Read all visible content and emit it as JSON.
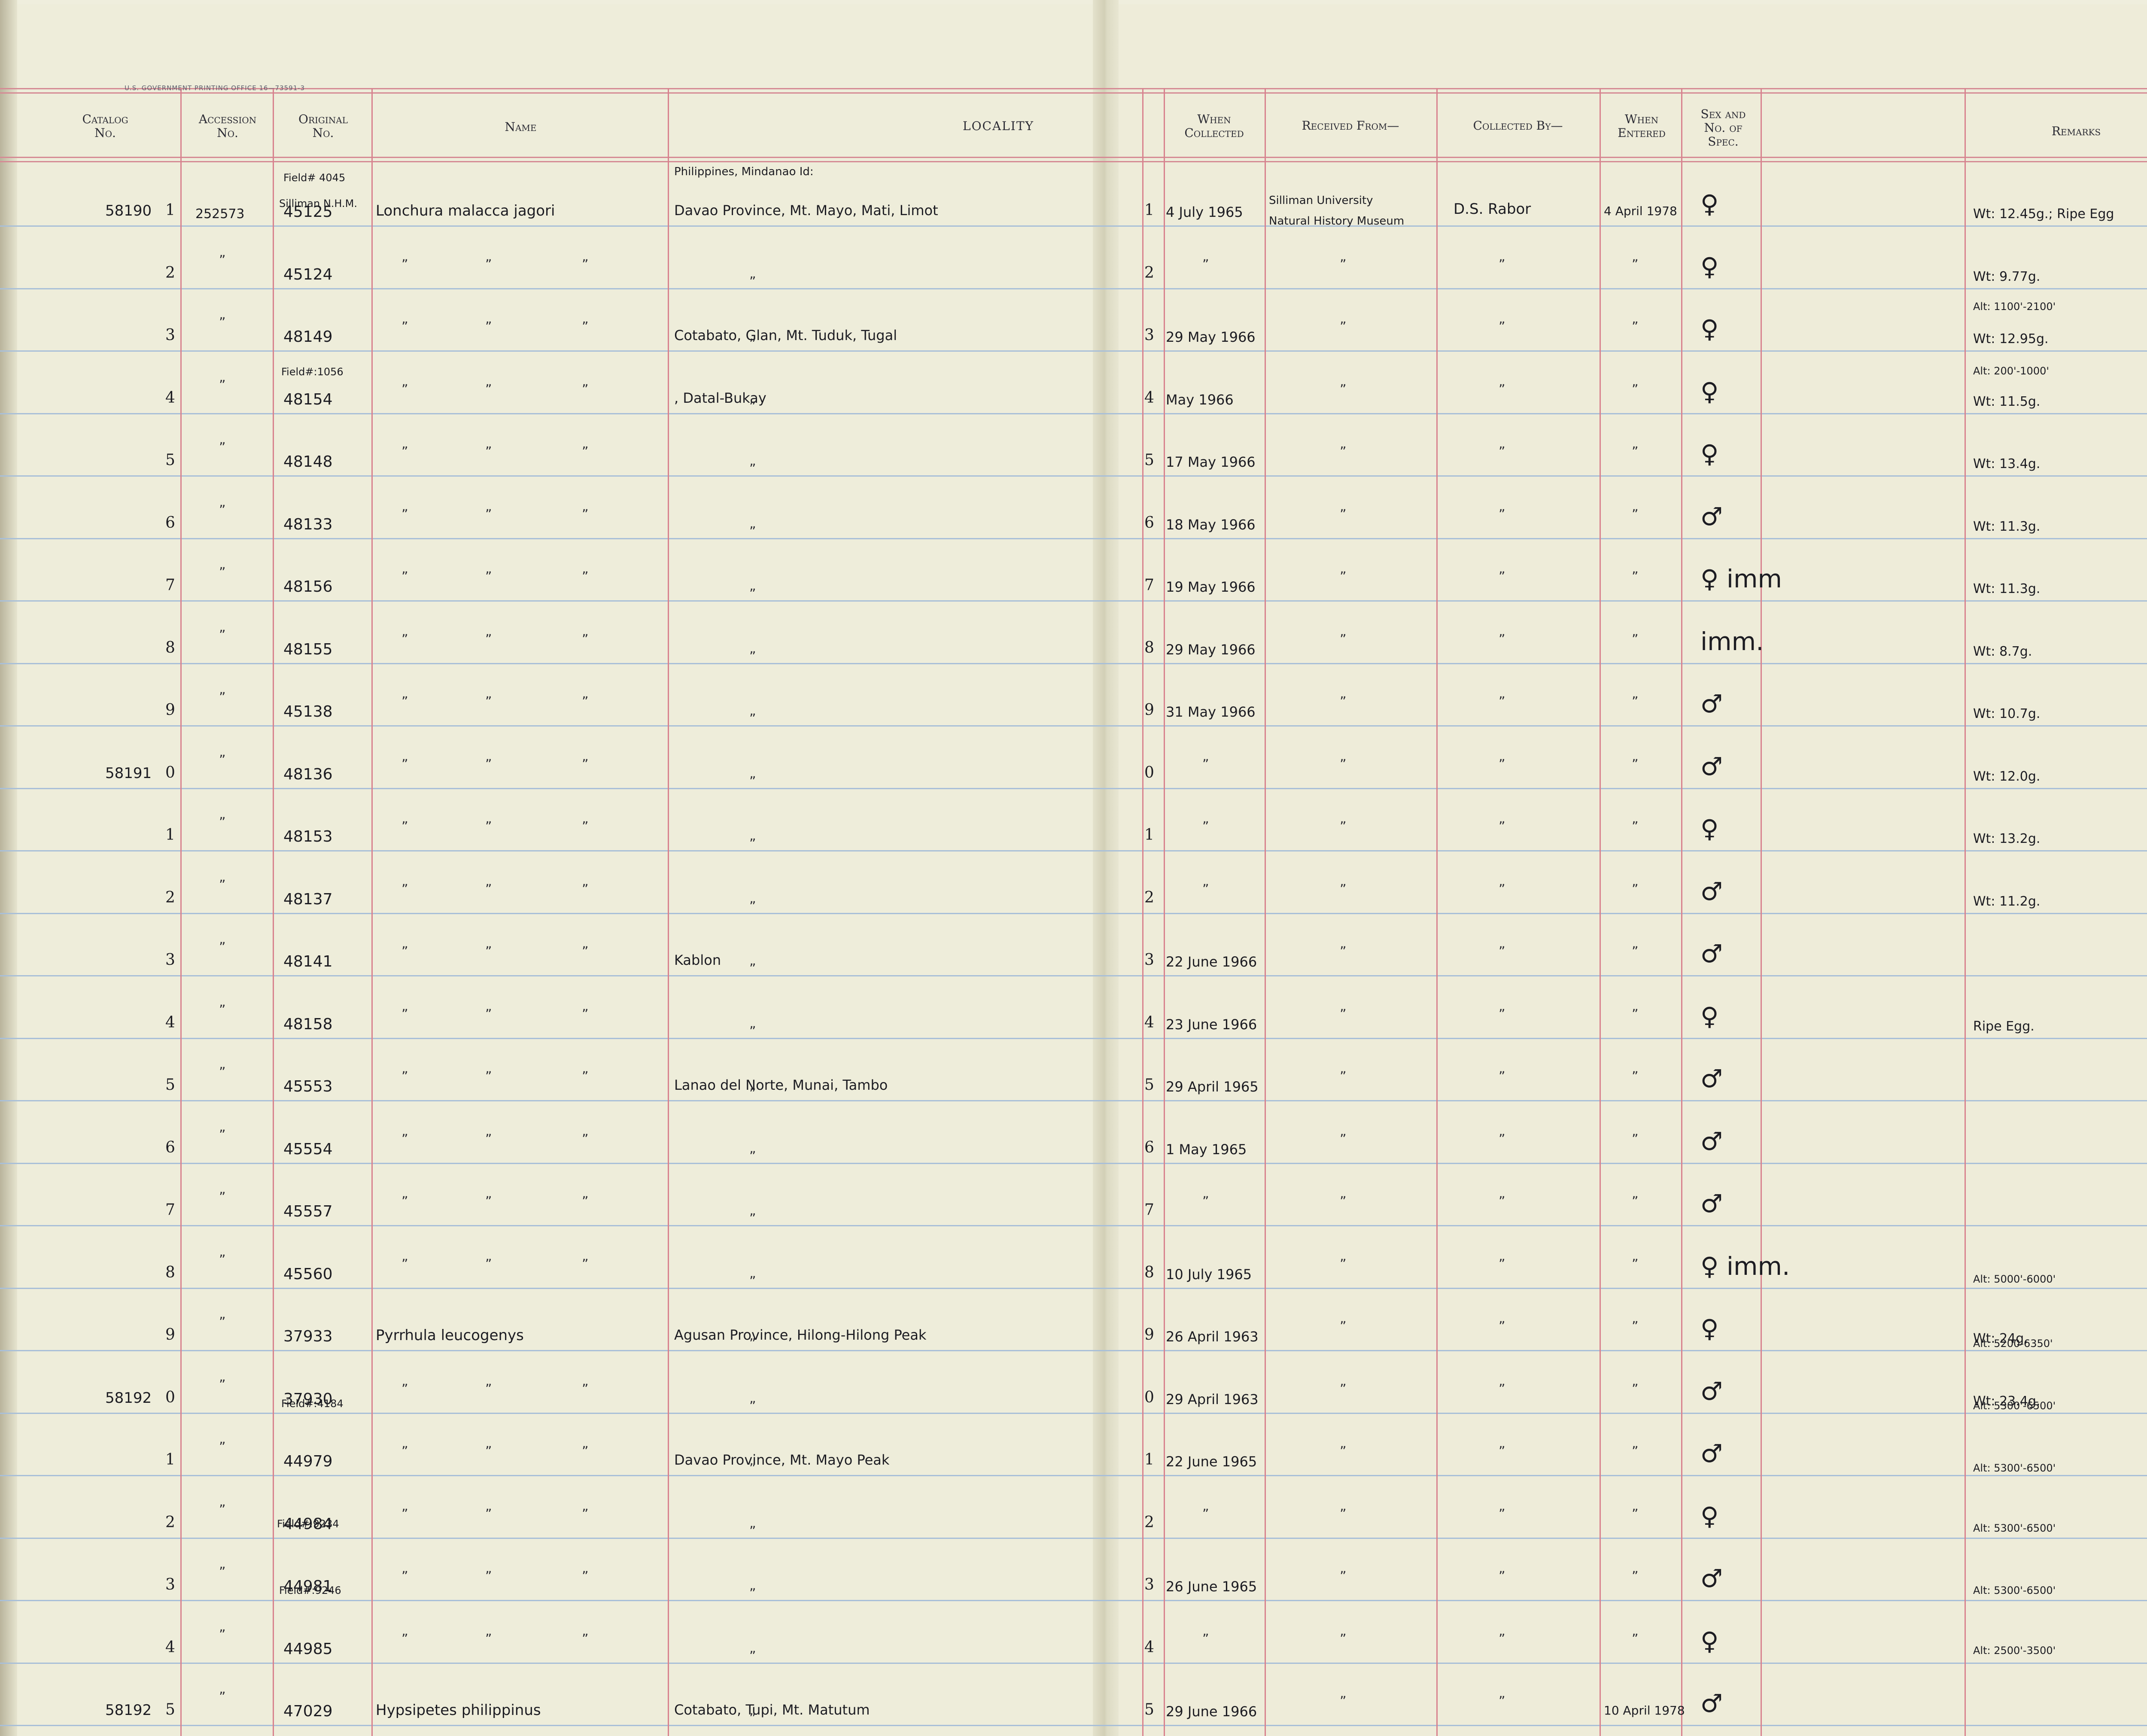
{
  "print_header": "U.S. GOVERNMENT PRINTING OFFICE   16—73591-3",
  "columns": {
    "catalog": [
      "Catalog",
      "No."
    ],
    "accession": [
      "Accession",
      "No."
    ],
    "original": [
      "Original",
      "No."
    ],
    "name": [
      "Name"
    ],
    "locality": [
      "LOCALITY"
    ],
    "when_collected": [
      "When",
      "Collected"
    ],
    "received_from": [
      "Received From—"
    ],
    "collected_by": [
      "Collected By—"
    ],
    "when_entered": [
      "When",
      "Entered"
    ],
    "sex": [
      "Sex and",
      "No. of",
      "Spec."
    ],
    "remarks": [
      "Remarks"
    ]
  },
  "notes": {
    "field_4045": "Field# 4045",
    "silliman_nhm": "Silliman N.H.M.",
    "locality_head": "Philippines, Mindanao Id:",
    "received_line1": "Silliman University",
    "received_line2": "Natural History Museum",
    "field_1056": "Field#:1056",
    "field_4184": "Field#:4184",
    "field_9234": "Field#:9234",
    "field_9246": "Field#:9246",
    "rem_alt_1": "Alt: 1100'-2100'",
    "rem_alt_3": "Alt: 200'-1000'",
    "rem_alt_18": "Alt: 5000'-6000'",
    "rem_alt_19": "Alt: 5200-6350'",
    "rem_alt_20": "Alt: 5300'-6500'",
    "rem_alt_21": "Alt: 5300'-6500'",
    "rem_alt_22": "Alt: 5300'-6500'",
    "rem_alt_23": "Alt: 5300'-6500'",
    "rem_alt_24": "Alt: 2500'-3500'"
  },
  "rows": [
    {
      "cat": "58190",
      "n": "1",
      "acc": "252573",
      "orig": "45125",
      "name": "Lonchura malacca jagori",
      "loc": "Davao Province, Mt. Mayo, Mati, Limot",
      "n2": "1",
      "when": "4 July 1965",
      "coll": "D.S. Rabor",
      "ent": "4 April 1978",
      "sex": "♀",
      "rem": "Wt: 12.45g.; Ripe Egg"
    },
    {
      "cat": "",
      "n": "2",
      "acc": "",
      "orig": "45124",
      "name": "",
      "loc": "",
      "n2": "2",
      "when": "",
      "coll": "",
      "ent": "",
      "sex": "♀",
      "rem": "Wt: 9.77g."
    },
    {
      "cat": "",
      "n": "3",
      "acc": "",
      "orig": "48149",
      "name": "",
      "loc": "Cotabato, Glan, Mt. Tuduk, Tugal",
      "n2": "3",
      "when": "29 May 1966",
      "coll": "",
      "ent": "",
      "sex": "♀",
      "rem": "Wt: 12.95g."
    },
    {
      "cat": "",
      "n": "4",
      "acc": "",
      "orig": "48154",
      "name": "",
      "loc": ", Datal-Bukay",
      "n2": "4",
      "when": "May 1966",
      "coll": "",
      "ent": "",
      "sex": "♀",
      "rem": "Wt: 11.5g."
    },
    {
      "cat": "",
      "n": "5",
      "acc": "",
      "orig": "48148",
      "name": "",
      "loc": "",
      "n2": "5",
      "when": "17 May 1966",
      "coll": "",
      "ent": "",
      "sex": "♀",
      "rem": "Wt: 13.4g."
    },
    {
      "cat": "",
      "n": "6",
      "acc": "",
      "orig": "48133",
      "name": "",
      "loc": "",
      "n2": "6",
      "when": "18 May 1966",
      "coll": "",
      "ent": "",
      "sex": "♂",
      "rem": "Wt: 11.3g."
    },
    {
      "cat": "",
      "n": "7",
      "acc": "",
      "orig": "48156",
      "name": "",
      "loc": "",
      "n2": "7",
      "when": "19 May 1966",
      "coll": "",
      "ent": "",
      "sex": "♀ imm",
      "rem": "Wt: 11.3g."
    },
    {
      "cat": "",
      "n": "8",
      "acc": "",
      "orig": "48155",
      "name": "",
      "loc": "",
      "n2": "8",
      "when": "29 May 1966",
      "coll": "",
      "ent": "",
      "sex": "imm.",
      "rem": "Wt: 8.7g."
    },
    {
      "cat": "",
      "n": "9",
      "acc": "",
      "orig": "45138",
      "name": "",
      "loc": "",
      "n2": "9",
      "when": "31 May 1966",
      "coll": "",
      "ent": "",
      "sex": "♂",
      "rem": "Wt: 10.7g."
    },
    {
      "cat": "58191",
      "n": "0",
      "acc": "",
      "orig": "48136",
      "name": "",
      "loc": "",
      "n2": "0",
      "when": "",
      "coll": "",
      "ent": "",
      "sex": "♂",
      "rem": "Wt: 12.0g."
    },
    {
      "cat": "",
      "n": "1",
      "acc": "",
      "orig": "48153",
      "name": "",
      "loc": "",
      "n2": "1",
      "when": "",
      "coll": "",
      "ent": "",
      "sex": "♀",
      "rem": "Wt: 13.2g."
    },
    {
      "cat": "",
      "n": "2",
      "acc": "",
      "orig": "48137",
      "name": "",
      "loc": "",
      "n2": "2",
      "when": "",
      "coll": "",
      "ent": "",
      "sex": "♂",
      "rem": "Wt: 11.2g."
    },
    {
      "cat": "",
      "n": "3",
      "acc": "",
      "orig": "48141",
      "name": "",
      "loc": "Kablon",
      "n2": "3",
      "when": "22 June 1966",
      "coll": "",
      "ent": "",
      "sex": "♂",
      "rem": ""
    },
    {
      "cat": "",
      "n": "4",
      "acc": "",
      "orig": "48158",
      "name": "",
      "loc": "",
      "n2": "4",
      "when": "23 June 1966",
      "coll": "",
      "ent": "",
      "sex": "♀",
      "rem": "Ripe Egg."
    },
    {
      "cat": "",
      "n": "5",
      "acc": "",
      "orig": "45553",
      "name": "",
      "loc": "Lanao del Norte, Munai, Tambo",
      "n2": "5",
      "when": "29 April 1965",
      "coll": "",
      "ent": "",
      "sex": "♂",
      "rem": ""
    },
    {
      "cat": "",
      "n": "6",
      "acc": "",
      "orig": "45554",
      "name": "",
      "loc": "",
      "n2": "6",
      "when": "1 May 1965",
      "coll": "",
      "ent": "",
      "sex": "♂",
      "rem": ""
    },
    {
      "cat": "",
      "n": "7",
      "acc": "",
      "orig": "45557",
      "name": "",
      "loc": "",
      "n2": "7",
      "when": "",
      "coll": "",
      "ent": "",
      "sex": "♂",
      "rem": ""
    },
    {
      "cat": "",
      "n": "8",
      "acc": "",
      "orig": "45560",
      "name": "",
      "loc": "",
      "n2": "8",
      "when": "10 July 1965",
      "coll": "",
      "ent": "",
      "sex": "♀ imm.",
      "rem": ""
    },
    {
      "cat": "",
      "n": "9",
      "acc": "",
      "orig": "37933",
      "name": "Pyrrhula leucogenys",
      "loc": "Agusan Province, Hilong-Hilong Peak",
      "n2": "9",
      "when": "26 April 1963",
      "coll": "",
      "ent": "",
      "sex": "♀",
      "rem": "Wt: 24g."
    },
    {
      "cat": "58192",
      "n": "0",
      "acc": "",
      "orig": "37930",
      "name": "",
      "loc": "",
      "n2": "0",
      "when": "29 April 1963",
      "coll": "",
      "ent": "",
      "sex": "♂",
      "rem": "Wt: 23.4g."
    },
    {
      "cat": "",
      "n": "1",
      "acc": "",
      "orig": "44979",
      "name": "",
      "loc": "Davao Province, Mt. Mayo Peak",
      "n2": "1",
      "when": "22 June 1965",
      "coll": "",
      "ent": "",
      "sex": "♂",
      "rem": ""
    },
    {
      "cat": "",
      "n": "2",
      "acc": "",
      "orig": "44984",
      "name": "",
      "loc": "",
      "n2": "2",
      "when": "",
      "coll": "",
      "ent": "",
      "sex": "♀",
      "rem": ""
    },
    {
      "cat": "",
      "n": "3",
      "acc": "",
      "orig": "44981",
      "name": "",
      "loc": "",
      "n2": "3",
      "when": "26 June 1965",
      "coll": "",
      "ent": "",
      "sex": "♂",
      "rem": ""
    },
    {
      "cat": "",
      "n": "4",
      "acc": "",
      "orig": "44985",
      "name": "",
      "loc": "",
      "n2": "4",
      "when": "",
      "coll": "",
      "ent": "",
      "sex": "♀",
      "rem": ""
    },
    {
      "cat": "58192",
      "n": "5",
      "acc": "",
      "orig": "47029",
      "name": "Hypsipetes philippinus",
      "loc": "Cotabato, Tupi, Mt. Matutum",
      "n2": "5",
      "when": "29 June 1966",
      "coll": "",
      "ent": "10 April 1978",
      "sex": "♂",
      "rem": ""
    }
  ]
}
